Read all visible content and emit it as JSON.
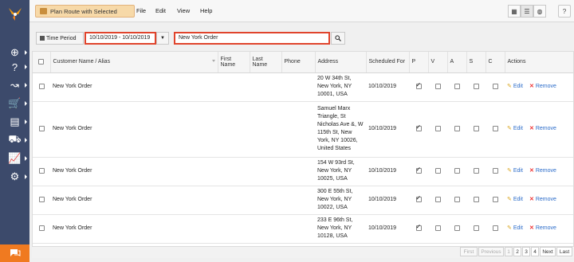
{
  "toolbar": {
    "plan_route_label": "Plan Route with Selected",
    "menu": [
      "File",
      "Edit",
      "View",
      "Help"
    ]
  },
  "filter": {
    "time_period_label": "Time Period",
    "date_range": "10/10/2019 - 10/10/2019",
    "search_value": "New York Order"
  },
  "table": {
    "headers": {
      "customer": "Customer Name / Alias",
      "first_name": "First Name",
      "last_name": "Last Name",
      "phone": "Phone",
      "address": "Address",
      "scheduled_for": "Scheduled For",
      "p": "P",
      "v": "V",
      "a": "A",
      "s": "S",
      "c": "C",
      "actions": "Actions"
    },
    "rows": [
      {
        "customer": "New York Order",
        "address": "20 W 34th St, New York, NY 10001, USA",
        "scheduled": "10/10/2019",
        "p": true
      },
      {
        "customer": "New York Order",
        "address": "Samuel Marx Triangle, St Nicholas Ave &, W 115th St, New York, NY 10026, United States",
        "scheduled": "10/10/2019",
        "p": true
      },
      {
        "customer": "New York Order",
        "address": "154 W 93rd St, New York, NY 10025, USA",
        "scheduled": "10/10/2019",
        "p": true
      },
      {
        "customer": "New York Order",
        "address": "300 E 55th St, New York, NY 10022, USA",
        "scheduled": "10/10/2019",
        "p": true
      },
      {
        "customer": "New York Order",
        "address": "233 E 96th St, New York, NY 10128, USA",
        "scheduled": "10/10/2019",
        "p": true
      }
    ],
    "edit_label": "Edit",
    "remove_label": "Remove"
  },
  "pager": {
    "first": "First",
    "previous": "Previous",
    "pages": [
      "1",
      "2",
      "3",
      "4"
    ],
    "next": "Next",
    "last": "Last"
  },
  "colors": {
    "sidebar": "#3c4a6b",
    "accent_orange": "#f07a20",
    "highlight_red": "#e0442c",
    "link_blue": "#2a6bc9"
  }
}
